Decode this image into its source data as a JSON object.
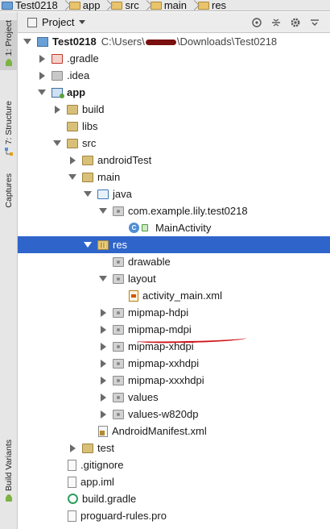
{
  "breadcrumb": [
    "Test0218",
    "app",
    "src",
    "main",
    "res"
  ],
  "toolstrip": {
    "project_tab": "1: Project",
    "structure_tab": "7: Structure",
    "captures_tab": "Captures",
    "build_variants_tab": "Build Variants"
  },
  "toolbar": {
    "view_selector": "Project",
    "buttons": [
      "target-icon",
      "collapse-icon",
      "gear-icon",
      "hide-icon"
    ]
  },
  "tree": {
    "root_label": "Test0218",
    "root_path_prefix": "C:\\Users\\",
    "root_path_suffix": "\\Downloads\\Test0218",
    "items": [
      {
        "label": "Test0218",
        "indent": 0,
        "state": "down",
        "icon": "module"
      },
      {
        "label": ".gradle",
        "indent": 1,
        "state": "right",
        "icon": "excluded"
      },
      {
        "label": ".idea",
        "indent": 1,
        "state": "right",
        "icon": "grey"
      },
      {
        "label": "app",
        "indent": 1,
        "state": "down",
        "icon": "app",
        "bold": true
      },
      {
        "label": "build",
        "indent": 2,
        "state": "right",
        "icon": "folder"
      },
      {
        "label": "libs",
        "indent": 2,
        "state": "none",
        "icon": "folder"
      },
      {
        "label": "src",
        "indent": 2,
        "state": "down",
        "icon": "folder"
      },
      {
        "label": "androidTest",
        "indent": 3,
        "state": "right",
        "icon": "folder"
      },
      {
        "label": "main",
        "indent": 3,
        "state": "down",
        "icon": "folder"
      },
      {
        "label": "java",
        "indent": 4,
        "state": "down",
        "icon": "java"
      },
      {
        "label": "com.example.lily.test0218",
        "indent": 5,
        "state": "down",
        "icon": "pkg"
      },
      {
        "label": "MainActivity",
        "indent": 6,
        "state": "none",
        "icon": "class"
      },
      {
        "label": "res",
        "indent": 4,
        "state": "down",
        "icon": "res",
        "selected": true
      },
      {
        "label": "drawable",
        "indent": 5,
        "state": "none",
        "icon": "pkg"
      },
      {
        "label": "layout",
        "indent": 5,
        "state": "down",
        "icon": "pkg"
      },
      {
        "label": "activity_main.xml",
        "indent": 6,
        "state": "none",
        "icon": "xmlfile"
      },
      {
        "label": "mipmap-hdpi",
        "indent": 5,
        "state": "right",
        "icon": "pkg"
      },
      {
        "label": "mipmap-mdpi",
        "indent": 5,
        "state": "right",
        "icon": "pkg"
      },
      {
        "label": "mipmap-xhdpi",
        "indent": 5,
        "state": "right",
        "icon": "pkg"
      },
      {
        "label": "mipmap-xxhdpi",
        "indent": 5,
        "state": "right",
        "icon": "pkg"
      },
      {
        "label": "mipmap-xxxhdpi",
        "indent": 5,
        "state": "right",
        "icon": "pkg"
      },
      {
        "label": "values",
        "indent": 5,
        "state": "right",
        "icon": "pkg"
      },
      {
        "label": "values-w820dp",
        "indent": 5,
        "state": "right",
        "icon": "pkg"
      },
      {
        "label": "AndroidManifest.xml",
        "indent": 4,
        "state": "none",
        "icon": "manifest"
      },
      {
        "label": "test",
        "indent": 3,
        "state": "right",
        "icon": "folder"
      },
      {
        "label": ".gitignore",
        "indent": 2,
        "state": "none",
        "icon": "file"
      },
      {
        "label": "app.iml",
        "indent": 2,
        "state": "none",
        "icon": "file"
      },
      {
        "label": "build.gradle",
        "indent": 2,
        "state": "none",
        "icon": "gradle"
      },
      {
        "label": "proguard-rules.pro",
        "indent": 2,
        "state": "none",
        "icon": "file"
      }
    ]
  },
  "colors": {
    "selection": "#2f65ca",
    "annotation": "#d0131a"
  }
}
